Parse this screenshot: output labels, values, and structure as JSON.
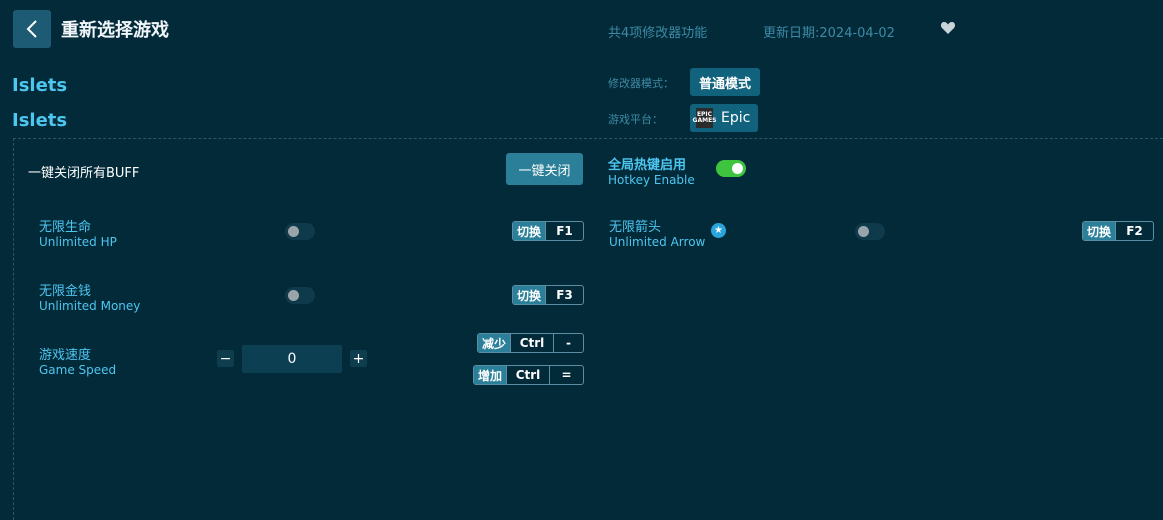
{
  "header": {
    "title": "重新选择游戏",
    "feature_count": "共4项修改器功能",
    "update_date": "更新日期:2024-04-02"
  },
  "game": {
    "name": "Islets",
    "name_alt": "Islets"
  },
  "settings": {
    "mode_label": "修改器模式：",
    "mode_value": "普通模式",
    "platform_label": "游戏平台：",
    "platform_value": "Epic",
    "platform_logo_text": "EPIC GAMES"
  },
  "buff": {
    "label": "一键关闭所有BUFF",
    "button": "一键关闭"
  },
  "hotkey_enable": {
    "zh": "全局热键启用",
    "en": "Hotkey Enable",
    "enabled": true
  },
  "cheats": [
    {
      "zh": "无限生命",
      "en": "Unlimited HP",
      "action": "切换",
      "key": "F1",
      "enabled": false
    },
    {
      "zh": "无限金钱",
      "en": "Unlimited Money",
      "action": "切换",
      "key": "F3",
      "enabled": false
    },
    {
      "zh": "无限箭头",
      "en": "Unlimited Arrow",
      "action": "切换",
      "key": "F2",
      "enabled": false,
      "starred": true
    }
  ],
  "speed": {
    "zh": "游戏速度",
    "en": "Game Speed",
    "value": "0",
    "minus": "−",
    "plus": "+",
    "decrease": {
      "action": "减少",
      "mod": "Ctrl",
      "key": "-"
    },
    "increase": {
      "action": "增加",
      "mod": "Ctrl",
      "key": "="
    }
  },
  "icons": {
    "back": "chevron-left-icon",
    "favorite": "heart-icon",
    "star": "star-icon"
  },
  "colors": {
    "background": "#032a39",
    "accent": "#4dc6f0",
    "button": "#2b7f98",
    "toggle_on": "#3fc43f"
  }
}
